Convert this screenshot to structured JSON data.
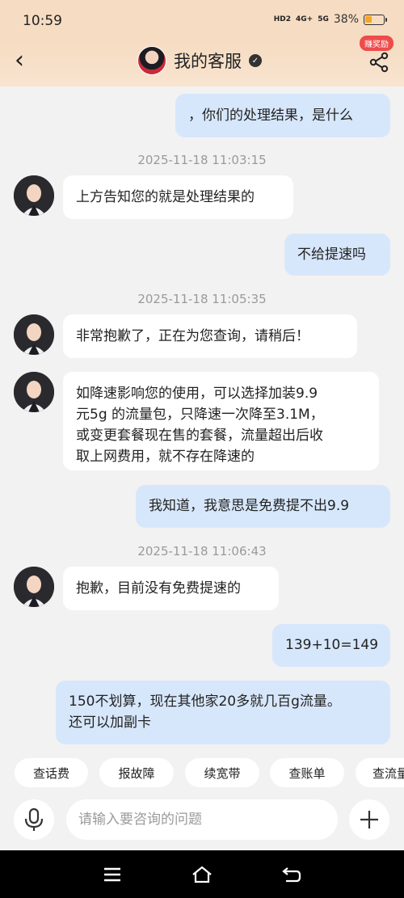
{
  "status": {
    "time": "10:59",
    "hd": "HD2",
    "net1": "4G+",
    "net2": "5G",
    "battery_pct": "38%",
    "battery_level": 0.38,
    "battery_color": "#f5a623"
  },
  "header": {
    "back_icon": "chevron-left-icon",
    "title": "我的客服",
    "verified_icon": "check-circle-icon",
    "reward_badge": "赚奖励",
    "share_icon": "share-icon"
  },
  "messages": [
    {
      "side": "right",
      "text": "，你们的处理结果，是什么"
    },
    {
      "ts": "2025-11-18 11:03:15"
    },
    {
      "side": "left",
      "text": "上方告知您的就是处理结果的"
    },
    {
      "side": "right",
      "text": "不给提速吗"
    },
    {
      "ts": "2025-11-18 11:05:35"
    },
    {
      "side": "left",
      "text": "非常抱歉了，正在为您查询，请稍后！"
    },
    {
      "side": "left",
      "lines": [
        "如降速影响您的使用，可以选择加装9.9",
        "元5g 的流量包，只降速一次降至3.1M，",
        "或变更套餐现在售的套餐，流量超出后收",
        "取上网费用，就不存在降速的"
      ]
    },
    {
      "side": "right",
      "text": "我知道，我意思是免费提不出9.9"
    },
    {
      "ts": "2025-11-18 11:06:43"
    },
    {
      "side": "left",
      "text": "抱歉，目前没有免费提速的"
    },
    {
      "side": "right",
      "text": "139+10=149"
    },
    {
      "side": "right",
      "lines": [
        "150不划算，现在其他家20多就几百g流量。",
        "还可以加副卡"
      ]
    }
  ],
  "quick_actions": [
    "查话费",
    "报故障",
    "续宽带",
    "查账单",
    "查流量"
  ],
  "composer": {
    "placeholder": "请输入要咨询的问题",
    "mic_icon": "microphone-icon",
    "plus_icon": "plus-icon"
  },
  "navbar": {
    "icons": [
      "menu-icon",
      "home-icon",
      "back-icon"
    ]
  },
  "colors": {
    "header_bg": "#f6dcc2",
    "user_bubble": "#d7e7fb",
    "agent_bubble": "#ffffff",
    "chat_bg": "#f2f2f2",
    "reward_badge": "#ee4b4b"
  }
}
